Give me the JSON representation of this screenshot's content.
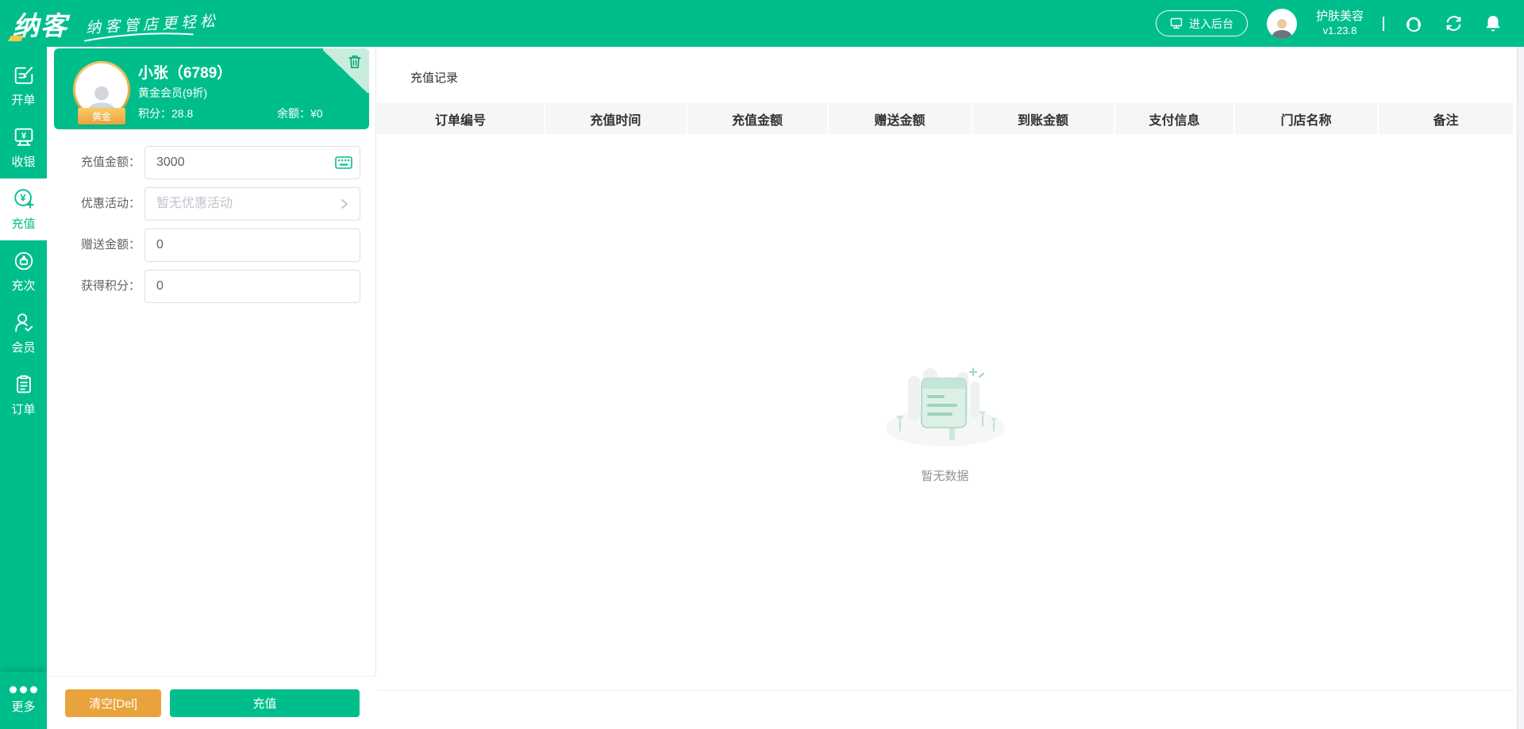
{
  "app": {
    "logo": "纳客",
    "tagline": "纳客管店更轻松"
  },
  "header": {
    "enter_backend_label": "进入后台",
    "store_name": "护肤美容",
    "version": "v1.23.8"
  },
  "sidebar": {
    "items": [
      {
        "label": "开单"
      },
      {
        "label": "收银"
      },
      {
        "label": "充值"
      },
      {
        "label": "充次"
      },
      {
        "label": "会员"
      },
      {
        "label": "订单"
      }
    ],
    "more_label": "更多"
  },
  "member_card": {
    "name": "小张（6789）",
    "level": "黄金会员(9折)",
    "badge": "黄金",
    "points_label": "积分：",
    "points_value": "28.8",
    "balance_label": "余额：",
    "balance_value": "¥0"
  },
  "form": {
    "fields": [
      {
        "label": "充值金额：",
        "value": "3000"
      },
      {
        "label": "优惠活动：",
        "placeholder": "暂无优惠活动"
      },
      {
        "label": "赠送金额：",
        "value": "0"
      },
      {
        "label": "获得积分：",
        "value": "0"
      }
    ]
  },
  "actions": {
    "clear_label": "清空[Del]",
    "recharge_label": "充值"
  },
  "records": {
    "title": "充值记录",
    "columns": [
      "订单编号",
      "充值时间",
      "充值金额",
      "赠送金额",
      "到账金额",
      "支付信息",
      "门店名称",
      "备注"
    ],
    "empty_text": "暂无数据"
  },
  "colors": {
    "primary": "#00be8c",
    "warning": "#e9a33c",
    "card_fold": "#c9ecdc",
    "table_header_bg": "#f5f6f7",
    "gold_badge": "#e8a23d"
  },
  "icons": {
    "header": [
      "monitor-icon",
      "avatar",
      "support-icon",
      "sync-icon",
      "bell-icon"
    ],
    "sidebar": [
      "bill-icon",
      "cashier-icon",
      "recharge-icon",
      "times-card-icon",
      "member-icon",
      "order-icon",
      "more-dots-icon"
    ],
    "form": [
      "keyboard-icon",
      "chevron-right-icon",
      "trash-icon"
    ]
  }
}
